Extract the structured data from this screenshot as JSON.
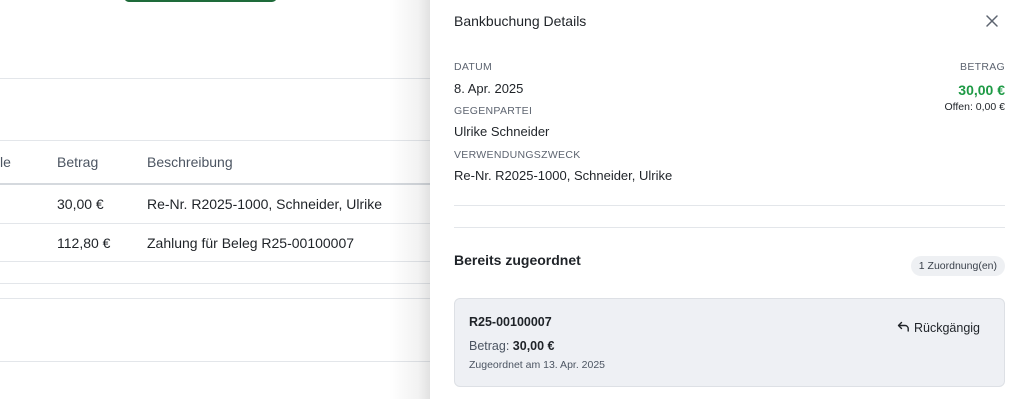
{
  "background_table": {
    "headers": [
      "le",
      "Betrag",
      "Beschreibung"
    ],
    "rows": [
      {
        "betrag": "30,00 €",
        "beschreibung": "Re-Nr. R2025-1000, Schneider, Ulrike"
      },
      {
        "betrag": "112,80 €",
        "beschreibung": "Zahlung für Beleg R25-00100007"
      }
    ]
  },
  "drawer": {
    "title": "Bankbuchung Details",
    "close_icon": "close-icon",
    "datum_label": "DATUM",
    "datum_value": "8. Apr. 2025",
    "betrag_label": "BETRAG",
    "betrag_value": "30,00 €",
    "offen_value": "Offen: 0,00 €",
    "gegenpartei_label": "GEGENPARTEI",
    "gegenpartei_value": "Ulrike Schneider",
    "zweck_label": "VERWENDUNGSZWECK",
    "zweck_value": "Re-Nr. R2025-1000, Schneider, Ulrike"
  },
  "assigned": {
    "title": "Bereits zugeordnet",
    "count_badge": "1 Zuordnung(en)",
    "item": {
      "ref": "R25-00100007",
      "amount_label": "Betrag:",
      "amount_value": "30,00 €",
      "date_text": "Zugeordnet am 13. Apr. 2025",
      "undo_label": "Rückgängig",
      "undo_icon": "undo-icon"
    }
  },
  "colors": {
    "accent_green": "#1e9a45",
    "button_green": "#1e6b3a"
  }
}
